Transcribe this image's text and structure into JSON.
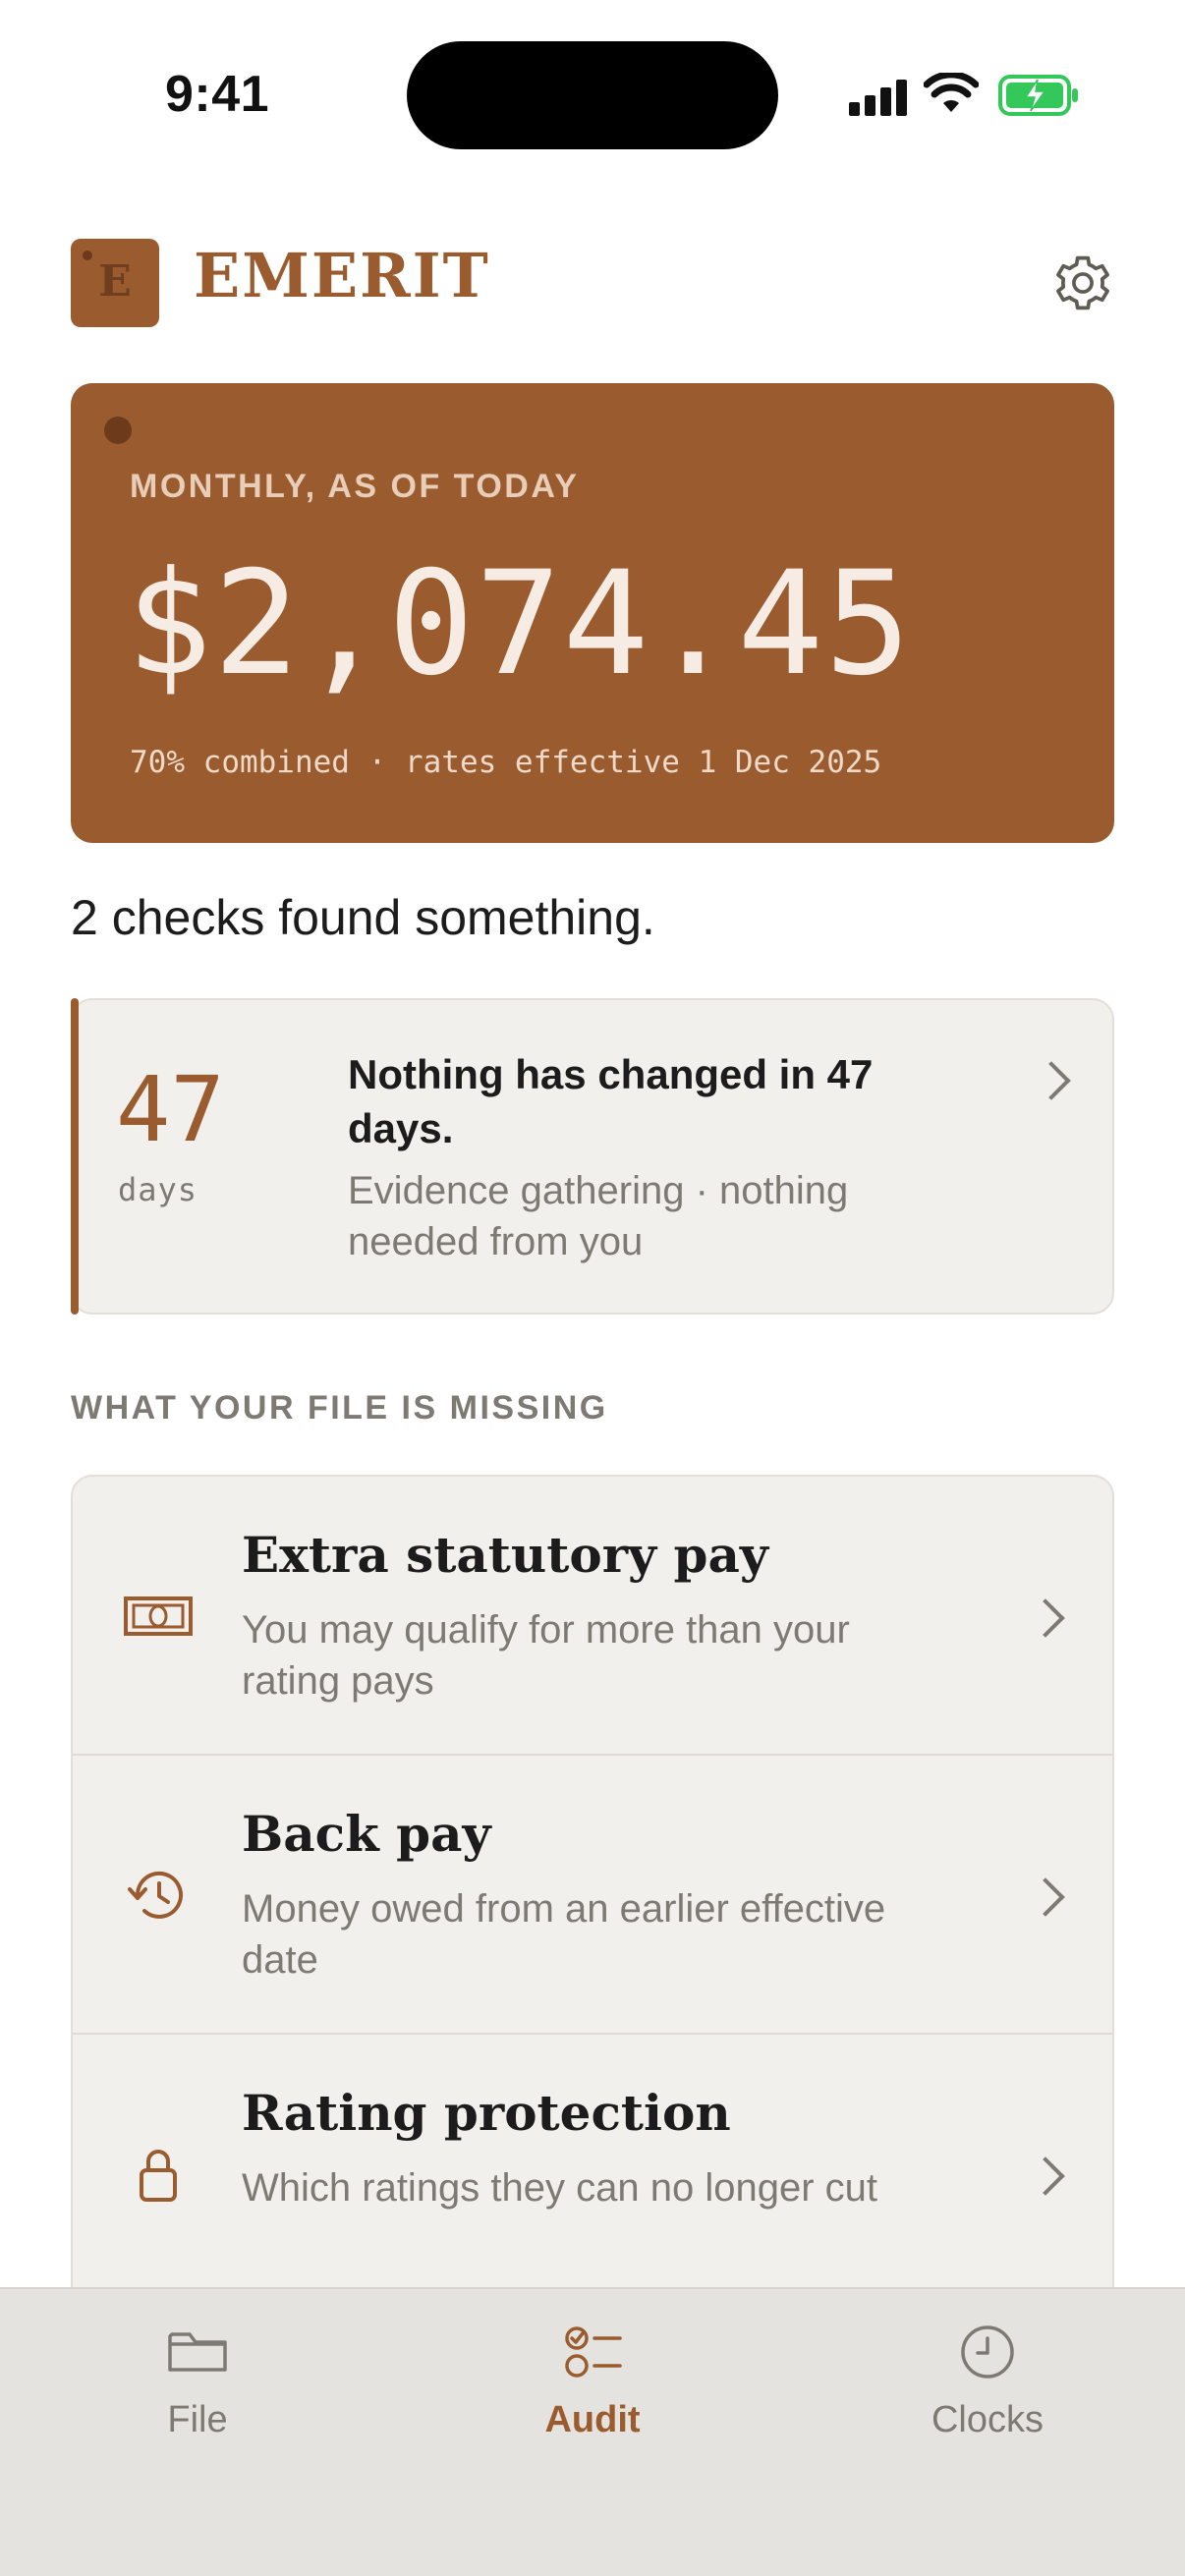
{
  "status_bar": {
    "time": "9:41"
  },
  "header": {
    "logo_letter": "E",
    "app_title": "EMERIT",
    "settings_icon": "gear-icon"
  },
  "amount_card": {
    "label": "MONTHLY, AS OF TODAY",
    "amount": "$2,074.45",
    "footnote": "70% combined · rates effective 1 Dec 2025"
  },
  "checks_message": "2 checks found something.",
  "countdown": {
    "number": "47",
    "unit": "days",
    "title": "Nothing has changed in 47 days.",
    "subtitle": "Evidence gathering · nothing needed from you"
  },
  "missing": {
    "heading": "WHAT YOUR FILE IS MISSING",
    "items": [
      {
        "title": "Extra statutory pay",
        "subtitle": "You may qualify for more than your rating pays",
        "icon": "money-bill-icon"
      },
      {
        "title": "Back pay",
        "subtitle": "Money owed from an earlier effective date",
        "icon": "history-icon"
      },
      {
        "title": "Rating protection",
        "subtitle": "Which ratings they can no longer cut",
        "icon": "lock-icon"
      }
    ]
  },
  "tabs": [
    {
      "label": "File",
      "icon": "folder-icon",
      "active": false
    },
    {
      "label": "Audit",
      "icon": "checklist-icon",
      "active": true
    },
    {
      "label": "Clocks",
      "icon": "clock-icon",
      "active": false
    }
  ],
  "colors": {
    "accent": "#9a5b2f",
    "card_bg": "#f1f0ed",
    "muted_text": "#7d7a74",
    "tab_bar_bg": "#e5e3df"
  }
}
